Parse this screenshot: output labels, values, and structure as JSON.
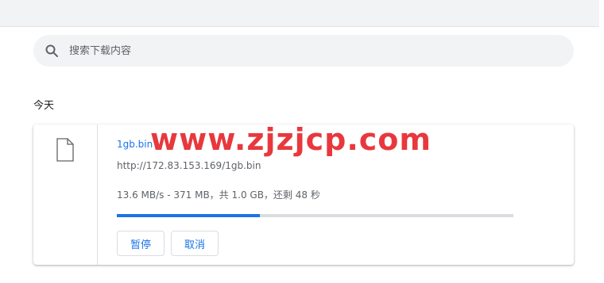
{
  "search": {
    "placeholder": "搜索下载内容",
    "icon": "search-icon"
  },
  "section": {
    "label": "今天"
  },
  "download": {
    "icon": "file-icon",
    "filename": "1gb.bin",
    "url": "http://172.83.153.169/1gb.bin",
    "status": "13.6 MB/s - 371 MB，共 1.0 GB，还剩 48 秒",
    "progress_fraction": 0.36,
    "pause_label": "暂停",
    "cancel_label": "取消"
  },
  "watermark": {
    "text": "www.zjzjcp.com",
    "color": "#e8383d"
  },
  "colors": {
    "accent": "#1a73e8",
    "secondary_text": "#5f6368",
    "track": "#dadce0"
  }
}
